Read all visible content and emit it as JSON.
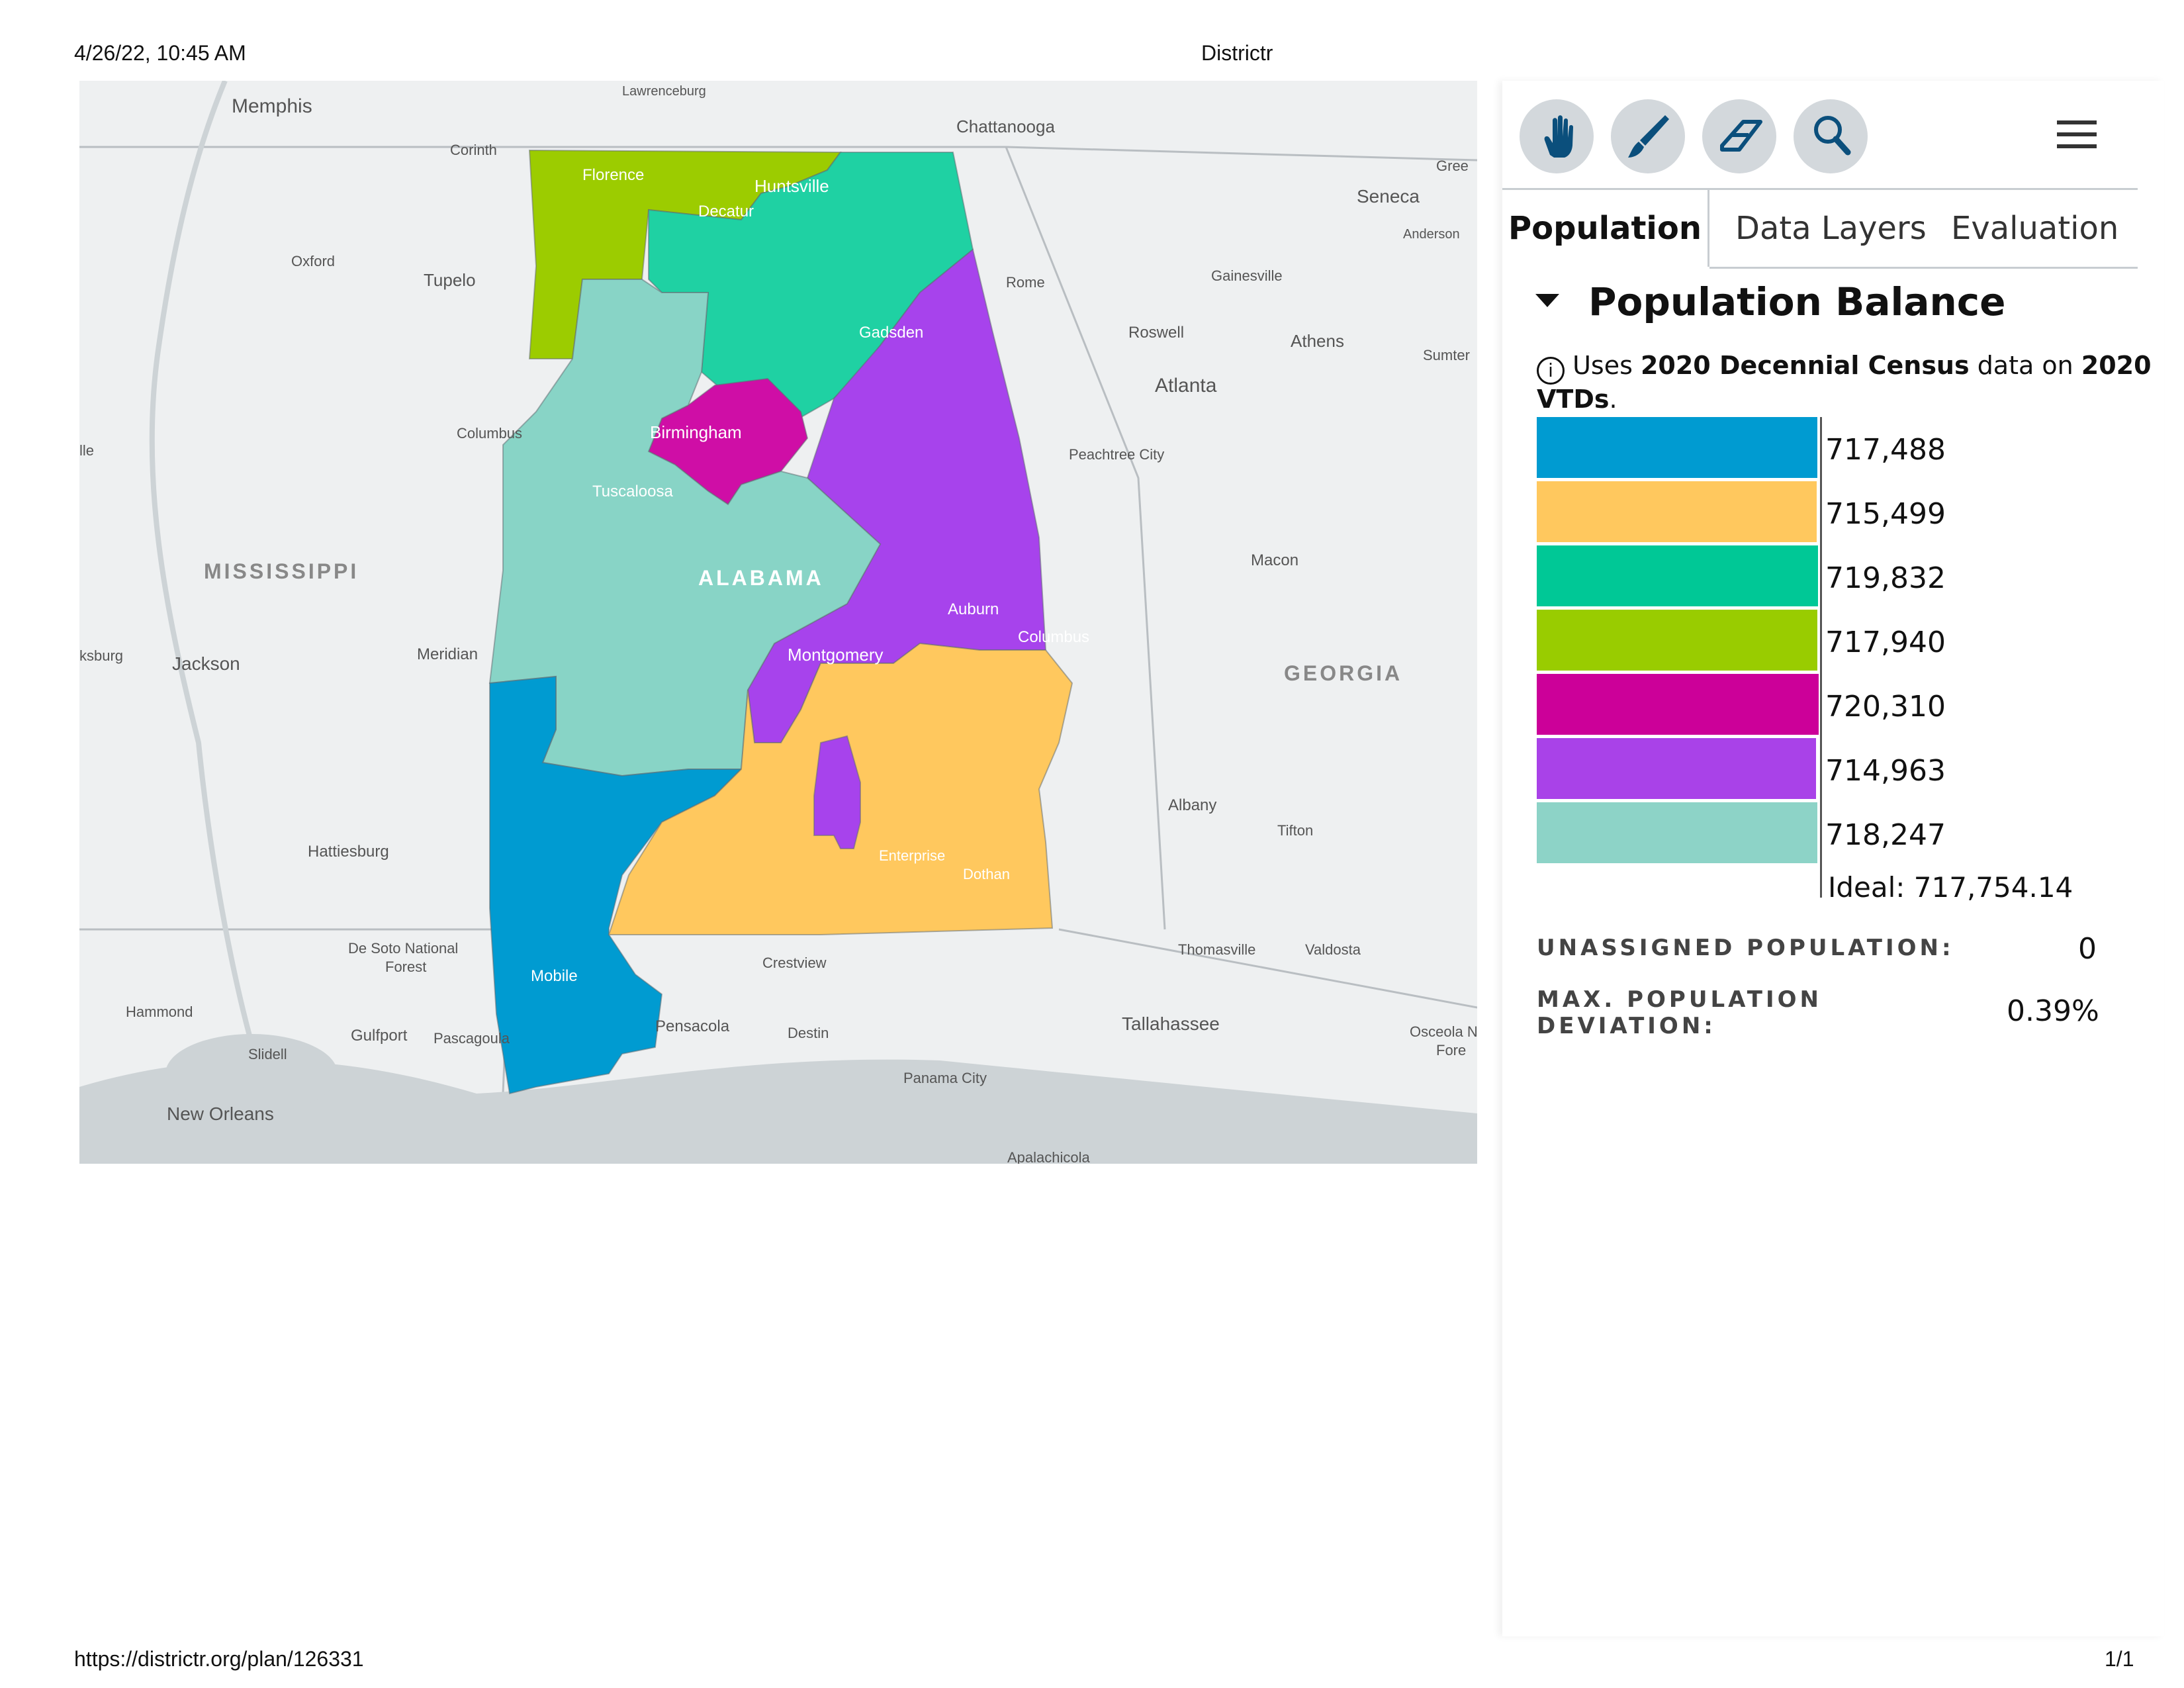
{
  "header": {
    "datetime": "4/26/22, 10:45 AM",
    "title": "Districtr"
  },
  "footer": {
    "url": "https://districtr.org/plan/126331",
    "page": "1/1"
  },
  "map": {
    "labels": {
      "memphis": "Memphis",
      "lawrenceburg": "Lawrenceburg",
      "chattanooga": "Chattanooga",
      "corinth": "Corinth",
      "florence": "Florence",
      "huntsville": "Huntsville",
      "decatur": "Decatur",
      "oxford": "Oxford",
      "tupelo": "Tupelo",
      "rome": "Rome",
      "gainesville": "Gainesville",
      "seneca": "Seneca",
      "anderson": "Anderson",
      "gree": "Gree",
      "gadsden": "Gadsden",
      "roswell": "Roswell",
      "athens": "Athens",
      "sumter": "Sumter",
      "atlanta": "Atlanta",
      "columbus_ms": "Columbus",
      "birmingham": "Birmingham",
      "peachtree": "Peachtree City",
      "tuscaloosa": "Tuscaloosa",
      "mississippi": "MISSISSIPPI",
      "alabama": "ALABAMA",
      "macon": "Macon",
      "auburn": "Auburn",
      "columbus_ga": "Columbus",
      "meridian": "Meridian",
      "jackson": "Jackson",
      "ksburg": "ksburg",
      "montgomery": "Montgomery",
      "georgia": "GEORGIA",
      "albany": "Albany",
      "tifton": "Tifton",
      "hattiesburg": "Hattiesburg",
      "enterprise": "Enterprise",
      "dothan": "Dothan",
      "desoto": "De Soto National",
      "forest": "Forest",
      "thomasville": "Thomasville",
      "valdosta": "Valdosta",
      "crestview": "Crestview",
      "mobile": "Mobile",
      "hammond": "Hammond",
      "tallahassee": "Tallahassee",
      "osceola": "Osceola N",
      "fore": "Fore",
      "pensacola": "Pensacola",
      "destin": "Destin",
      "slidell": "Slidell",
      "gulfport": "Gulfport",
      "pascagoula": "Pascagoula",
      "panama": "Panama City",
      "neworleans": "New Orleans",
      "apalachicola": "Apalachicola",
      "lle": "lle"
    },
    "colors": {
      "d1": "#009bd1",
      "d2": "#ffc85e",
      "d3": "#1fd1a3",
      "d4": "#9ccc00",
      "d5": "#cf0ea6",
      "d6": "#a743ec",
      "d7": "#88d4c6",
      "water": "#cdd3d6",
      "land": "#eef0f1"
    }
  },
  "toolbar": {
    "tools": [
      "pan-hand-icon",
      "brush-icon",
      "eraser-icon",
      "search-icon"
    ],
    "menu": "hamburger-icon"
  },
  "tabs": {
    "population": "Population",
    "data_layers": "Data Layers",
    "evaluation": "Evaluation"
  },
  "population": {
    "section_title": "Population Balance",
    "note_prefix": "Uses ",
    "note_dataset": "2020 Decennial Census",
    "note_mid": " data on ",
    "note_units": "2020 VTDs",
    "note_suffix": ".",
    "districts": [
      {
        "value_text": "717,488",
        "value": 717488,
        "color": "#009bd1"
      },
      {
        "value_text": "715,499",
        "value": 715499,
        "color": "#ffc85e"
      },
      {
        "value_text": "719,832",
        "value": 719832,
        "color": "#00c896"
      },
      {
        "value_text": "717,940",
        "value": 717940,
        "color": "#99cc00"
      },
      {
        "value_text": "720,310",
        "value": 720310,
        "color": "#cc0099"
      },
      {
        "value_text": "714,963",
        "value": 714963,
        "color": "#a942e8"
      },
      {
        "value_text": "718,247",
        "value": 718247,
        "color": "#8dd3c7"
      }
    ],
    "ideal_text": "Ideal: 717,754.14",
    "unassigned_label": "UNASSIGNED POPULATION:",
    "unassigned_value": "0",
    "deviation_label_1": "MAX. POPULATION",
    "deviation_label_2": "DEVIATION:",
    "deviation_value": "0.39%"
  }
}
